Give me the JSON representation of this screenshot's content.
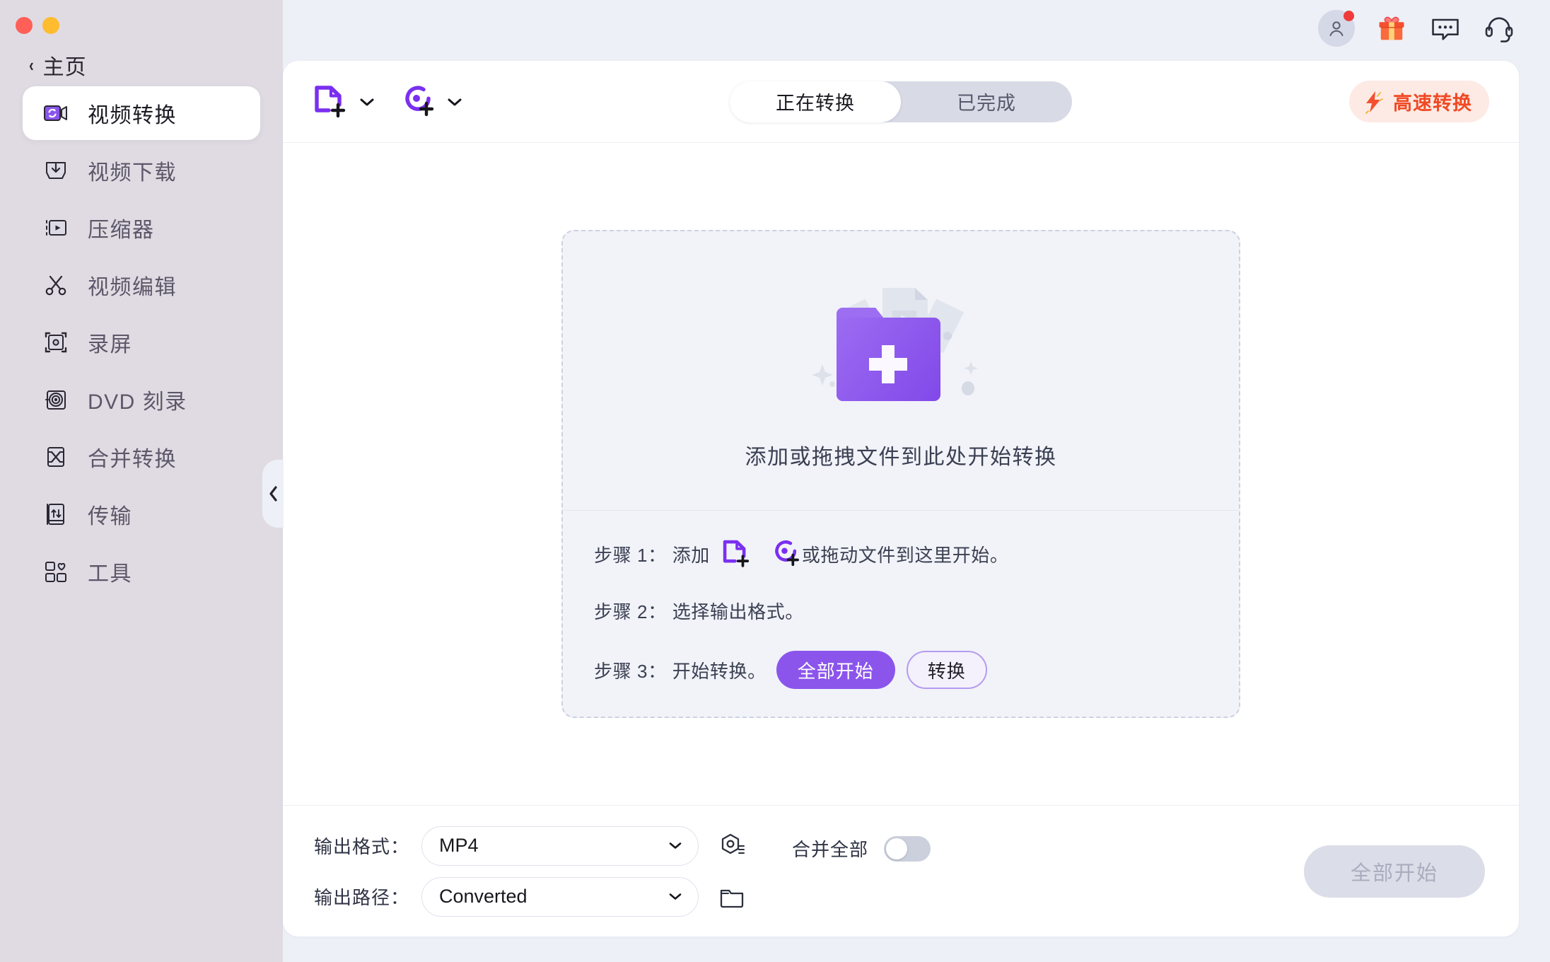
{
  "window": {
    "traffic_lights": [
      "close",
      "minimize"
    ]
  },
  "sidebar": {
    "home_label": "主页",
    "back_icon": "chevron-left-icon",
    "items": [
      {
        "label": "视频转换",
        "icon": "video-convert-icon",
        "active": true
      },
      {
        "label": "视频下载",
        "icon": "video-download-icon",
        "active": false
      },
      {
        "label": "压缩器",
        "icon": "compressor-icon",
        "active": false
      },
      {
        "label": "视频编辑",
        "icon": "scissors-icon",
        "active": false
      },
      {
        "label": "录屏",
        "icon": "screen-record-icon",
        "active": false
      },
      {
        "label": "DVD 刻录",
        "icon": "dvd-burn-icon",
        "active": false
      },
      {
        "label": "合并转换",
        "icon": "merge-convert-icon",
        "active": false
      },
      {
        "label": "传输",
        "icon": "transfer-icon",
        "active": false
      },
      {
        "label": "工具",
        "icon": "toolbox-icon",
        "active": false
      }
    ],
    "collapse_icon": "chevron-left-icon"
  },
  "topbar": {
    "icons": [
      {
        "name": "account-avatar-icon",
        "has_badge": true
      },
      {
        "name": "gift-icon",
        "has_badge": false
      },
      {
        "name": "feedback-chat-icon",
        "has_badge": false
      },
      {
        "name": "support-headset-icon",
        "has_badge": false
      }
    ]
  },
  "toolbar": {
    "add_file_icon": "add-file-icon",
    "add_disc_icon": "add-disc-icon",
    "dropdown_icon": "chevron-down-icon",
    "tabs": [
      {
        "label": "正在转换",
        "active": true
      },
      {
        "label": "已完成",
        "active": false
      }
    ],
    "speed_button": {
      "label": "高速转换",
      "icon": "lightning-bolt-icon",
      "text_color": "#f04a25",
      "bg_color": "#fdeae4"
    }
  },
  "dropzone": {
    "illustration_icon": "add-folder-illustration",
    "hint": "添加或拖拽文件到此处开始转换",
    "steps": [
      {
        "label": "步骤 1：",
        "text_before": "添加",
        "icons": [
          "add-file-icon",
          "add-disc-icon"
        ],
        "text_after": "或拖动文件到这里开始。"
      },
      {
        "label": "步骤 2：",
        "text_before": "选择输出格式。",
        "icons": [],
        "text_after": ""
      },
      {
        "label": "步骤 3：",
        "text_before": "开始转换。",
        "icons": [],
        "text_after": "",
        "buttons": [
          {
            "label": "全部开始",
            "style": "primary"
          },
          {
            "label": "转换",
            "style": "outline"
          }
        ]
      }
    ]
  },
  "footer": {
    "format_label": "输出格式：",
    "format_value": "MP4",
    "format_settings_icon": "settings-gear-icon",
    "path_label": "输出路径：",
    "path_value": "Converted",
    "path_browse_icon": "folder-icon",
    "merge_label": "合并全部",
    "merge_enabled": false,
    "start_all_label": "全部开始",
    "start_all_disabled": true,
    "dropdown_icon": "chevron-down-icon"
  },
  "theme": {
    "accent": "#8b55ec",
    "sidebar_bg": "#e0dbe2",
    "app_bg": "#eef0f7",
    "card_bg": "#ffffff",
    "dropzone_bg": "#f1f3f8",
    "danger": "#f04a25"
  }
}
